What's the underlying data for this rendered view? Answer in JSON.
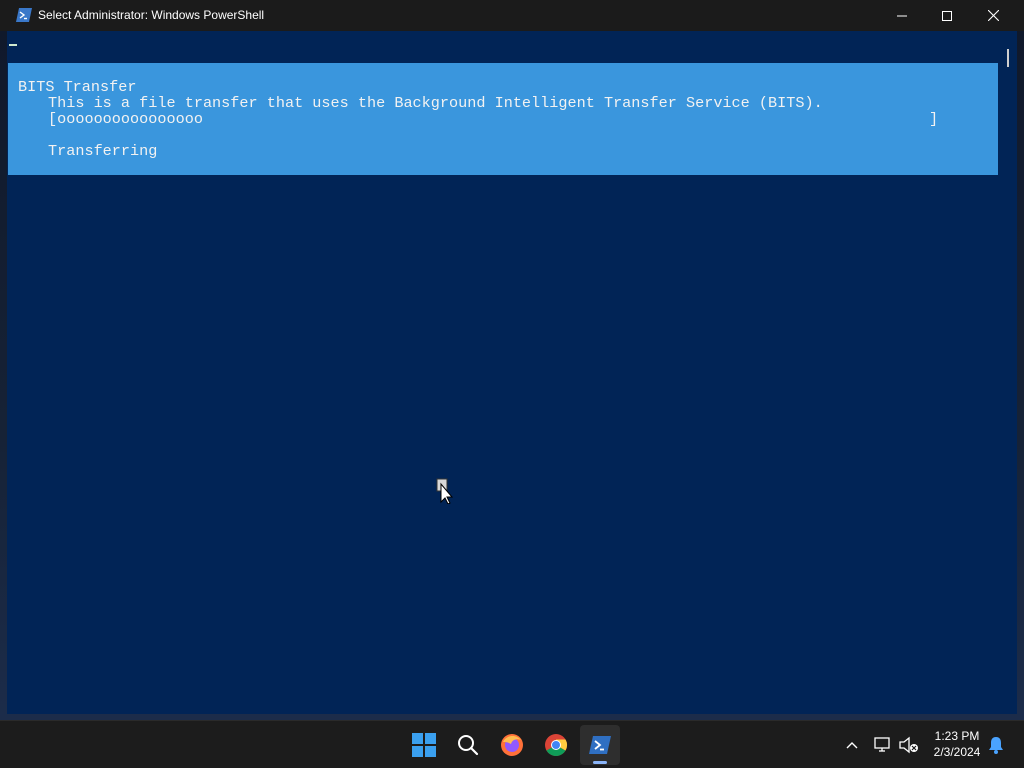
{
  "window": {
    "title": "Select Administrator: Windows PowerShell",
    "icon": "powershell-icon",
    "minimize_icon": "minimize-icon",
    "maximize_icon": "maximize-icon",
    "close_icon": "close-icon"
  },
  "console": {
    "background": "#012456",
    "progress": {
      "background": "#3a96dd",
      "activity": "BITS Transfer",
      "status": "This is a file transfer that uses the Background Intelligent Transfer Service (BITS).",
      "bar_text": "[oooooooooooooooo",
      "bar_end": "]",
      "operation": "Transferring"
    }
  },
  "taskbar": {
    "items": [
      {
        "name": "start-button",
        "icon": "windows-logo-icon"
      },
      {
        "name": "search-button",
        "icon": "search-icon"
      },
      {
        "name": "firefox-button",
        "icon": "firefox-icon"
      },
      {
        "name": "chrome-button",
        "icon": "chrome-icon"
      },
      {
        "name": "powershell-button",
        "icon": "powershell-icon",
        "active": true
      }
    ],
    "tray": {
      "chevron_icon": "chevron-up-icon",
      "network_icon": "network-icon",
      "volume_icon": "volume-muted-icon",
      "time": "1:23 PM",
      "date": "2/3/2024",
      "notification_icon": "bell-icon"
    }
  }
}
